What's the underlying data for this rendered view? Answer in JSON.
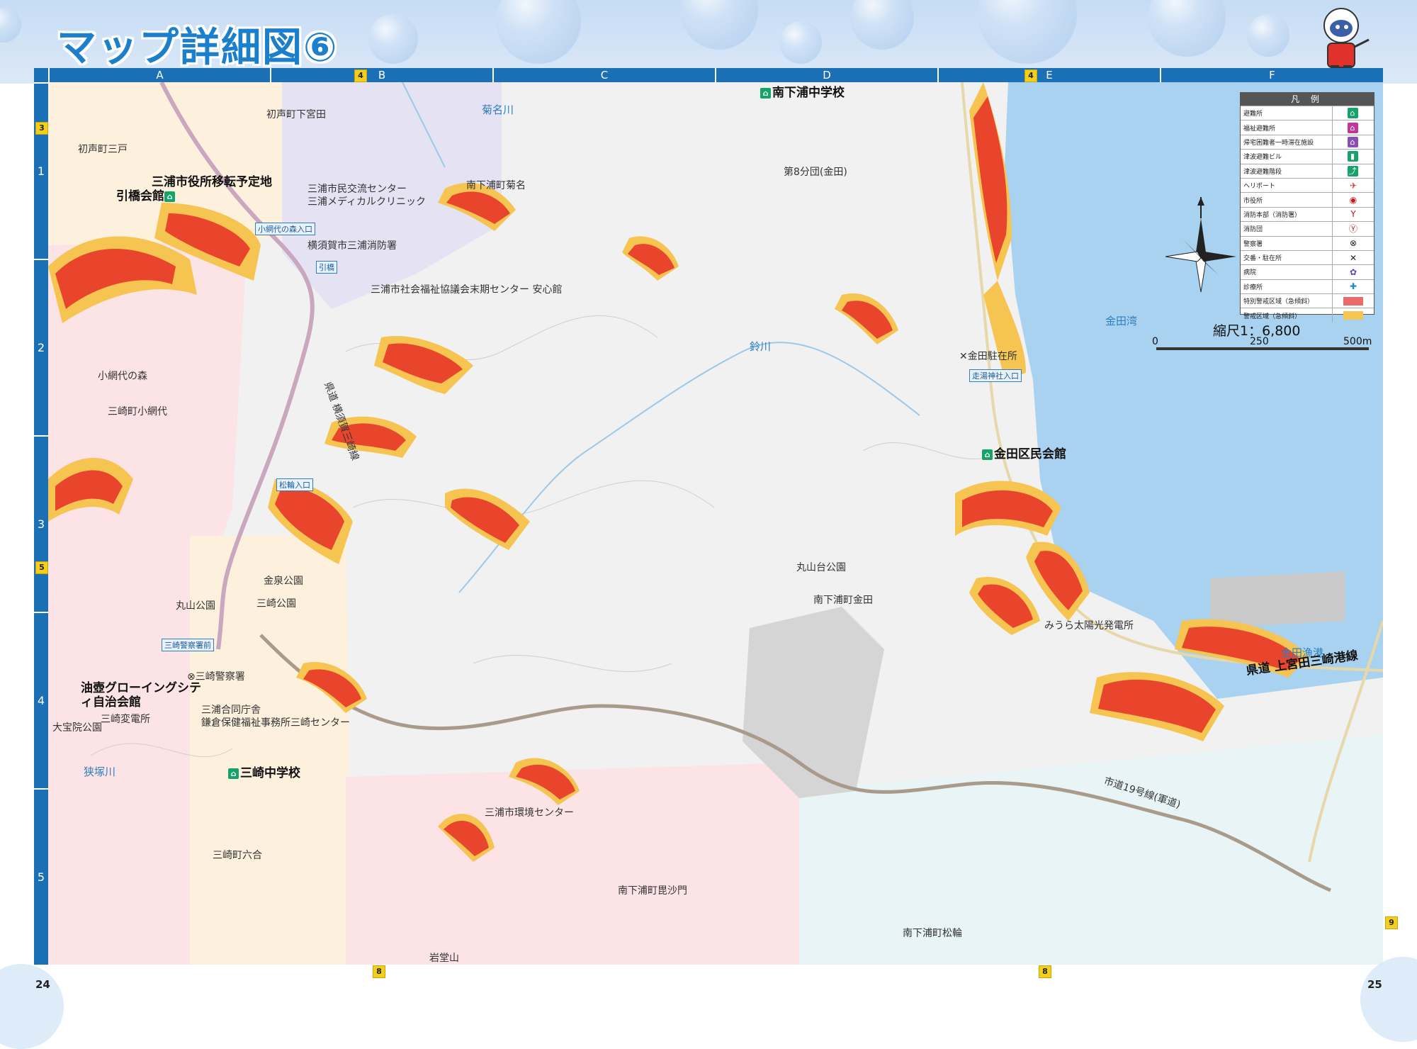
{
  "header": {
    "title": "マップ詳細図⑥"
  },
  "grid": {
    "columns": [
      "A",
      "B",
      "C",
      "D",
      "E",
      "F"
    ],
    "rows": [
      "1",
      "2",
      "3",
      "4",
      "5"
    ]
  },
  "markers": {
    "top_b": "4",
    "top_e": "4",
    "left_1": "3",
    "left_3": "5",
    "right_5": "9",
    "bottom_b": "8",
    "bottom_e": "8"
  },
  "page_numbers": {
    "left": "24",
    "right": "25"
  },
  "places": {
    "minami_shitaura_jhs": "南下浦中学校",
    "hatsukoe_shimoda": "初声町下宮田",
    "hatsukoe_misato": "初声町三戸",
    "city_hall_site": "三浦市役所移転予定地",
    "hikihashi_kaikan": "引橋会館",
    "civic_center": "三浦市民交流センター",
    "medical_clinic": "三浦メディカルクリニック",
    "kikuna_river": "菊名川",
    "minami_kikuna": "南下浦町菊名",
    "koajiro_entrance": "小網代の森入口",
    "fire_station": "横須賀市三浦消防署",
    "hikihashi_tag": "引橋",
    "welfare_center": "三浦市社会福祉協議会末期センター 安心館",
    "fire_brigade_8": "第8分団(金田)",
    "koajiro_forest": "小網代の森",
    "misaki_koajiro": "三崎町小網代",
    "prefectural_road": "県道 横須賀三崎線",
    "suzu_river": "鈴川",
    "kaneda_bay": "金田湾",
    "kaneda_koban": "金田駐在所",
    "shrine_entrance": "走湯神社入口",
    "kaneda_hall": "金田区民会館",
    "matsuwa_entrance": "松輪入口",
    "kinsen_park": "金泉公園",
    "maruyamadai_park": "丸山台公園",
    "misaki_park": "三崎公園",
    "maruyama_park2": "丸山公園",
    "minami_kaneda": "南下浦町金田",
    "misaki_police_tag": "三崎警察署前",
    "solar_plant": "みうら太陽光発電所",
    "kaneda_port": "金田漁港",
    "ariyama_hall": "油壺グローイングシティ自治会館",
    "misaki_police": "三崎警察署",
    "misaki_gov": "三浦合同庁舎",
    "kamakura_welfare": "鎌倉保健福祉事務所三崎センター",
    "misaki_substation": "三崎変電所",
    "daihoin_park": "大宝院公園",
    "kamiyada_road": "県道 上宮田三崎港線",
    "hazuka_river": "狭塚川",
    "misaki_jhs": "三崎中学校",
    "city_road_19": "市道19号線(軍道)",
    "env_center": "三浦市環境センター",
    "misaki_rokugo": "三崎町六合",
    "bishamon": "南下浦町毘沙門",
    "matsuwa": "南下浦町松輪",
    "iwadoyama": "岩堂山"
  },
  "legend": {
    "title": "凡 例",
    "items": [
      {
        "label": "避難所",
        "icon": "shelter-icon"
      },
      {
        "label": "福祉避難所",
        "icon": "welfare-shelter-icon"
      },
      {
        "label": "帰宅困難者一時滞在施設",
        "icon": "temporary-stay-icon"
      },
      {
        "label": "津波避難ビル",
        "icon": "tsunami-building-icon"
      },
      {
        "label": "津波避難階段",
        "icon": "tsunami-stairs-icon"
      },
      {
        "label": "ヘリポート",
        "icon": "heliport-icon"
      },
      {
        "label": "市役所",
        "icon": "city-hall-icon"
      },
      {
        "label": "消防本部（消防署）",
        "icon": "fire-hq-icon"
      },
      {
        "label": "消防団",
        "icon": "fire-brigade-icon"
      },
      {
        "label": "警察署",
        "icon": "police-icon"
      },
      {
        "label": "交番・駐在所",
        "icon": "police-box-icon"
      },
      {
        "label": "病院",
        "icon": "hospital-icon"
      },
      {
        "label": "診療所",
        "icon": "clinic-icon"
      },
      {
        "label": "特別警戒区域（急傾斜）",
        "icon": "special-warning-swatch"
      },
      {
        "label": "警戒区域（急傾斜）",
        "icon": "warning-swatch"
      }
    ]
  },
  "scale": {
    "title": "縮尺1：6,800",
    "ticks": [
      "0",
      "250",
      "500m"
    ]
  },
  "colors": {
    "special_zone": "#e8452c",
    "warning_zone": "#f5c451",
    "sea": "#a8d2ef",
    "grid_bar": "#1b6fb5"
  }
}
